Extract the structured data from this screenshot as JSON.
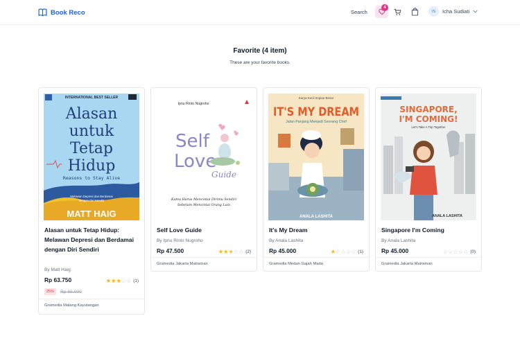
{
  "header": {
    "brand": "Book Reco",
    "search_label": "Search",
    "favorite_count": "4",
    "user_initials": "IS",
    "user_name": "Icha Sudiati"
  },
  "page": {
    "title": "Favorite (4 item)",
    "subtitle": "These are your favorite books."
  },
  "books": [
    {
      "title": "Alasan untuk Tetap Hidup: Melawan Depresi dan Berdamai dengan Diri Sendiri",
      "author": "By Matt Haig",
      "price": "Rp 63.750",
      "rating": 3,
      "rating_count": "(1)",
      "discount": "25%",
      "original_price": "Rp 85.000",
      "store": "Gramedia Malang Kayutangan",
      "cover": {
        "banner": "INTERNATIONAL BEST SELLER",
        "lines": [
          "Alasan",
          "untuk",
          "Tetap",
          "Hidup"
        ],
        "tagline": "Reasons to Stay Alive",
        "desc1": "Melawan Depresi dan Berdamai",
        "desc2": "dengan Diri Sendiri",
        "author": "MATT HAIG"
      }
    },
    {
      "title": "Self Love Guide",
      "author": "By Ipnu Rinto Nugroho",
      "price": "Rp 47.500",
      "rating": 2.5,
      "rating_count": "(2)",
      "store": "Gramedia Jakarta Matraman",
      "cover": {
        "author": "Ipnu Rinto Nugroho",
        "word1": "Self",
        "word2": "Love",
        "word3": "Guide",
        "tag1": "Kamu Harus Mencintai Dirimu Sendiri",
        "tag2": "Sebelum Mencintai Orang Lain"
      }
    },
    {
      "title": "It's My Dream",
      "author": "By Anala Lashita",
      "price": "Rp 45.000",
      "rating": 1,
      "rating_count": "(1)",
      "store": "Gramedia Medan Gajah Mada",
      "cover": {
        "top": "Karya Kecil Impian Besar",
        "big": "IT'S MY DREAM",
        "sub": "Jalan Panjang Menjadi Seorang Chef",
        "author": "ANALA LASHITA"
      }
    },
    {
      "title": "Singapore I'm Coming",
      "author": "By Anala Lashita",
      "price": "Rp 45.000",
      "rating": 0,
      "rating_count": "(0)",
      "store": "Gramedia Jakarta Matraman",
      "cover": {
        "line1": "SINGAPORE,",
        "line2": "I'M COMING!",
        "sub": "Let's Take A Trip Together",
        "author": "ANALA LASHITA"
      }
    }
  ],
  "colors": {
    "brand": "#1e63d6",
    "favorite_bg": "#fbe3f1",
    "badge": "#e0348a",
    "star": "#f5b91a",
    "discount_bg": "#fde2e2",
    "discount_text": "#d43838"
  },
  "icons": [
    "book-open-icon",
    "heart-icon",
    "cart-icon",
    "shopping-bag-icon",
    "chevron-down-icon",
    "star-icon"
  ]
}
